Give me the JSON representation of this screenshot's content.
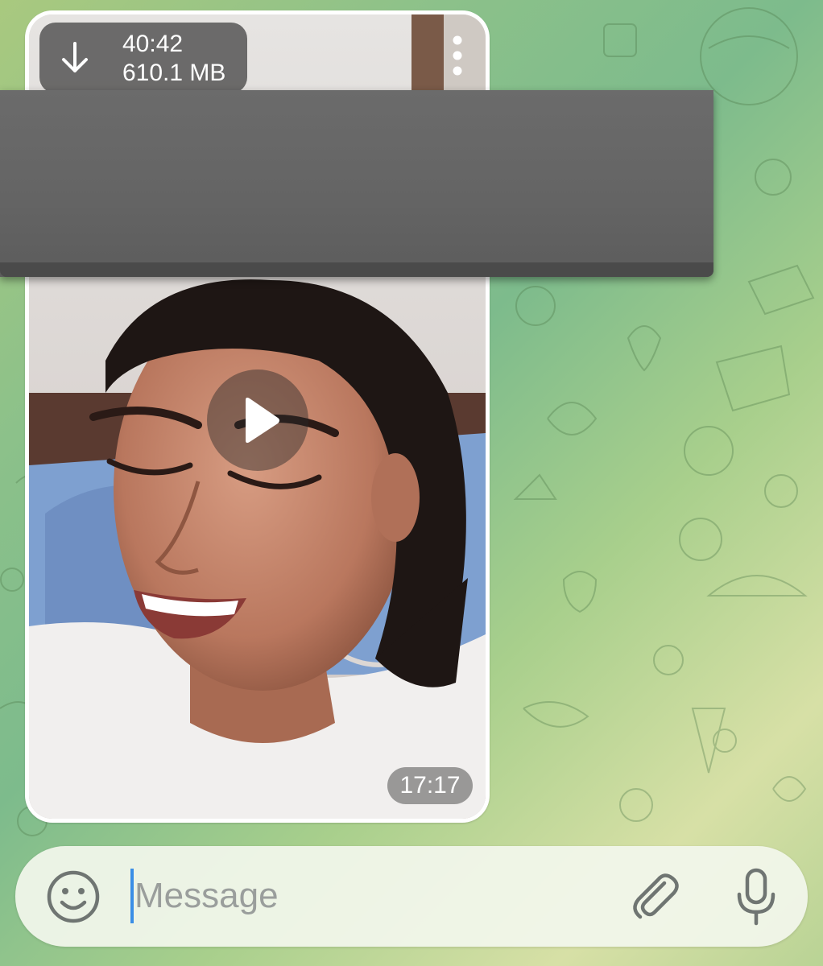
{
  "video_message": {
    "duration": "40:42",
    "file_size": "610.1 MB",
    "time_sent": "17:17",
    "download_icon": "arrow-down-icon",
    "menu_icon": "more-vertical-icon",
    "play_icon": "play-icon"
  },
  "composer": {
    "placeholder": "Message",
    "value": "",
    "emoji_icon": "smiley-icon",
    "attach_icon": "paperclip-icon",
    "mic_icon": "microphone-icon"
  },
  "colors": {
    "cursor": "#3a8ee6",
    "badge_bg": "#3c3c3c",
    "redaction": "#646464",
    "input_bg": "#f2f6ec"
  }
}
